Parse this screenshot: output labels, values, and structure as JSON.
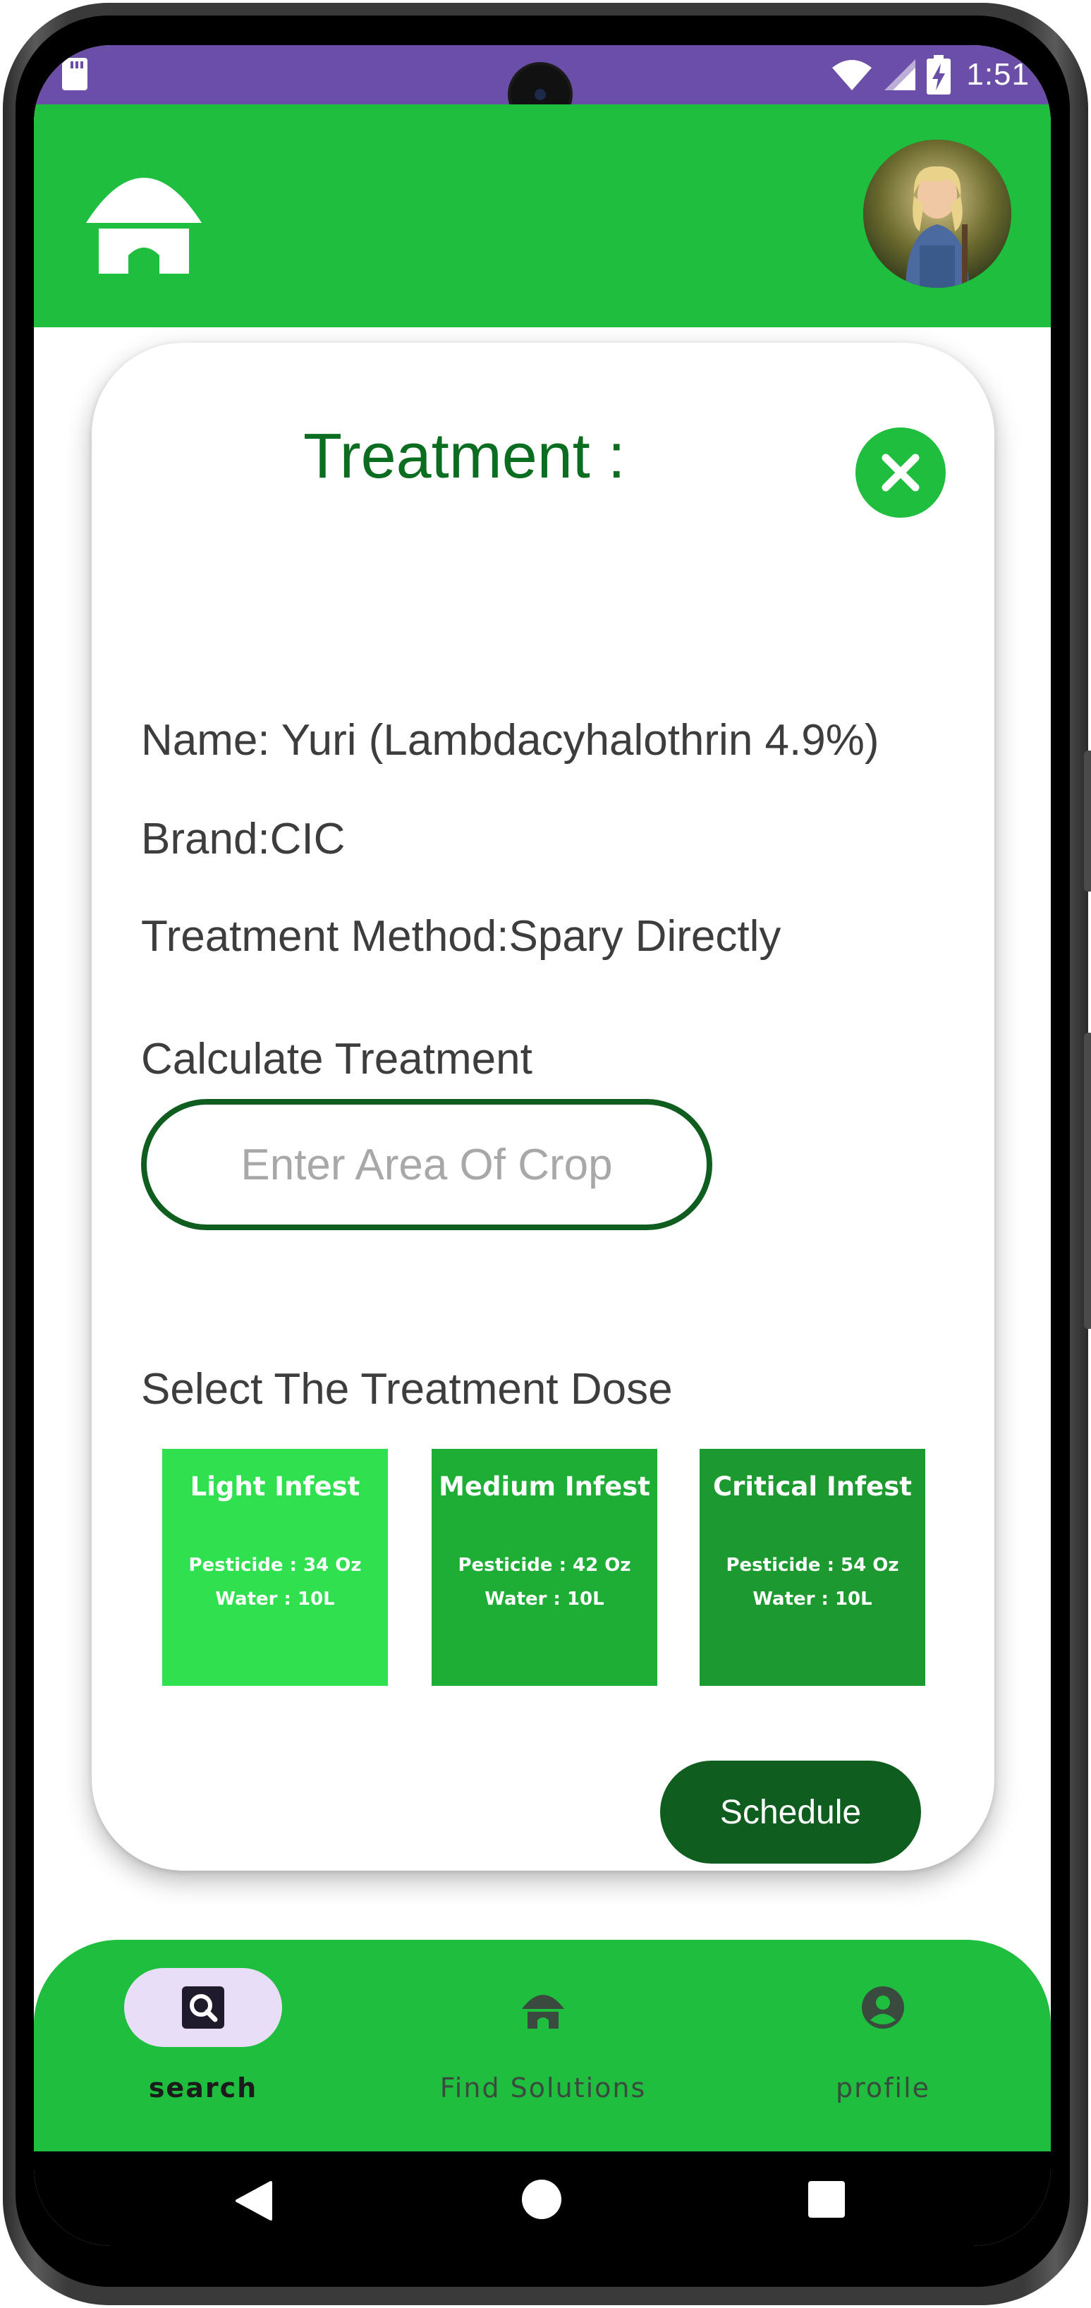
{
  "status_bar": {
    "time": "1:51"
  },
  "dialog": {
    "title": "Treatment :",
    "name_line": "Name: Yuri (Lambdacyhalothrin 4.9%)",
    "brand_line": "Brand:CIC",
    "method_line": "Treatment Method:Spary Directly",
    "calculate_label": "Calculate Treatment",
    "area_input": {
      "placeholder": "Enter Area Of Crop",
      "value": ""
    },
    "dose_label": "Select The Treatment Dose",
    "doses": [
      {
        "title": "Light Infest",
        "pesticide": "Pesticide : 34 Oz",
        "water": "Water : 10L",
        "color": "#2fe04f"
      },
      {
        "title": "Medium Infest",
        "pesticide": "Pesticide : 42 Oz",
        "water": "Water : 10L",
        "color": "#1eae35"
      },
      {
        "title": "Critical Infest",
        "pesticide": "Pesticide : 54 Oz",
        "water": "Water : 10L",
        "color": "#1c9a30"
      }
    ],
    "schedule_label": "Schedule"
  },
  "bottom_nav": {
    "items": [
      {
        "label": "search",
        "icon": "search-icon",
        "active": true
      },
      {
        "label": "Find Solutions",
        "icon": "home-icon",
        "active": false
      },
      {
        "label": "profile",
        "icon": "account-circle-icon",
        "active": false
      }
    ]
  },
  "colors": {
    "status_bar": "#6b4ea7",
    "app_bar": "#1fbe3e",
    "title_green": "#0b6d20",
    "dark_green": "#0f5e20",
    "active_pill": "#e8def8"
  }
}
